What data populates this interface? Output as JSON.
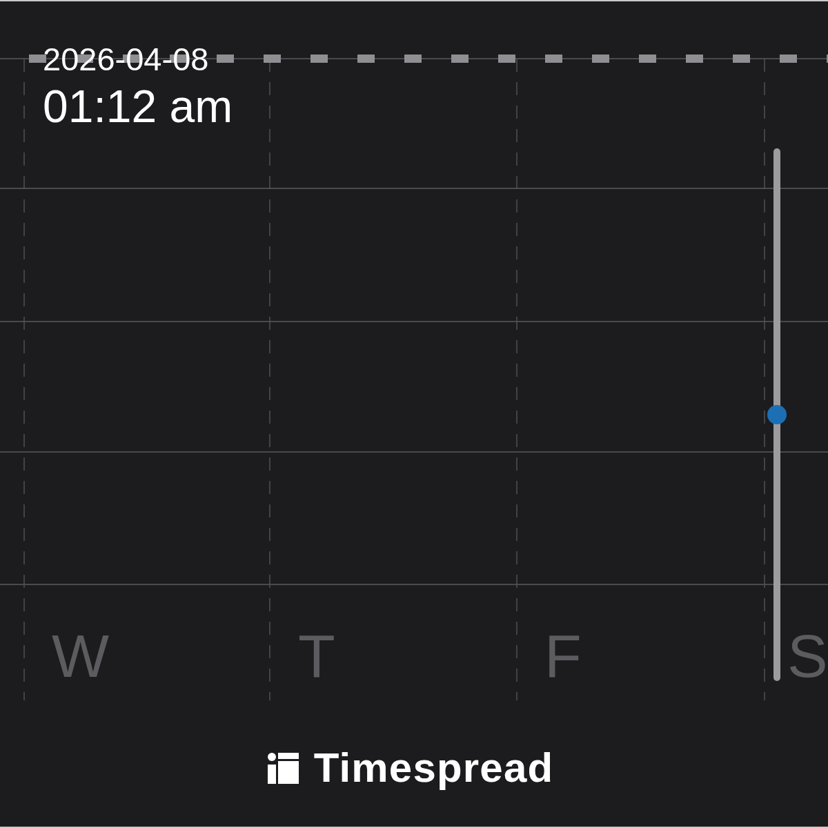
{
  "header": {
    "date": "2026-04-08",
    "time": "01:12 am"
  },
  "week": {
    "days": [
      {
        "label": "W"
      },
      {
        "label": "T"
      },
      {
        "label": "F"
      },
      {
        "label": "S"
      }
    ]
  },
  "time_slider": {
    "level": 0.5
  },
  "brand": {
    "name": "Timespread"
  }
}
